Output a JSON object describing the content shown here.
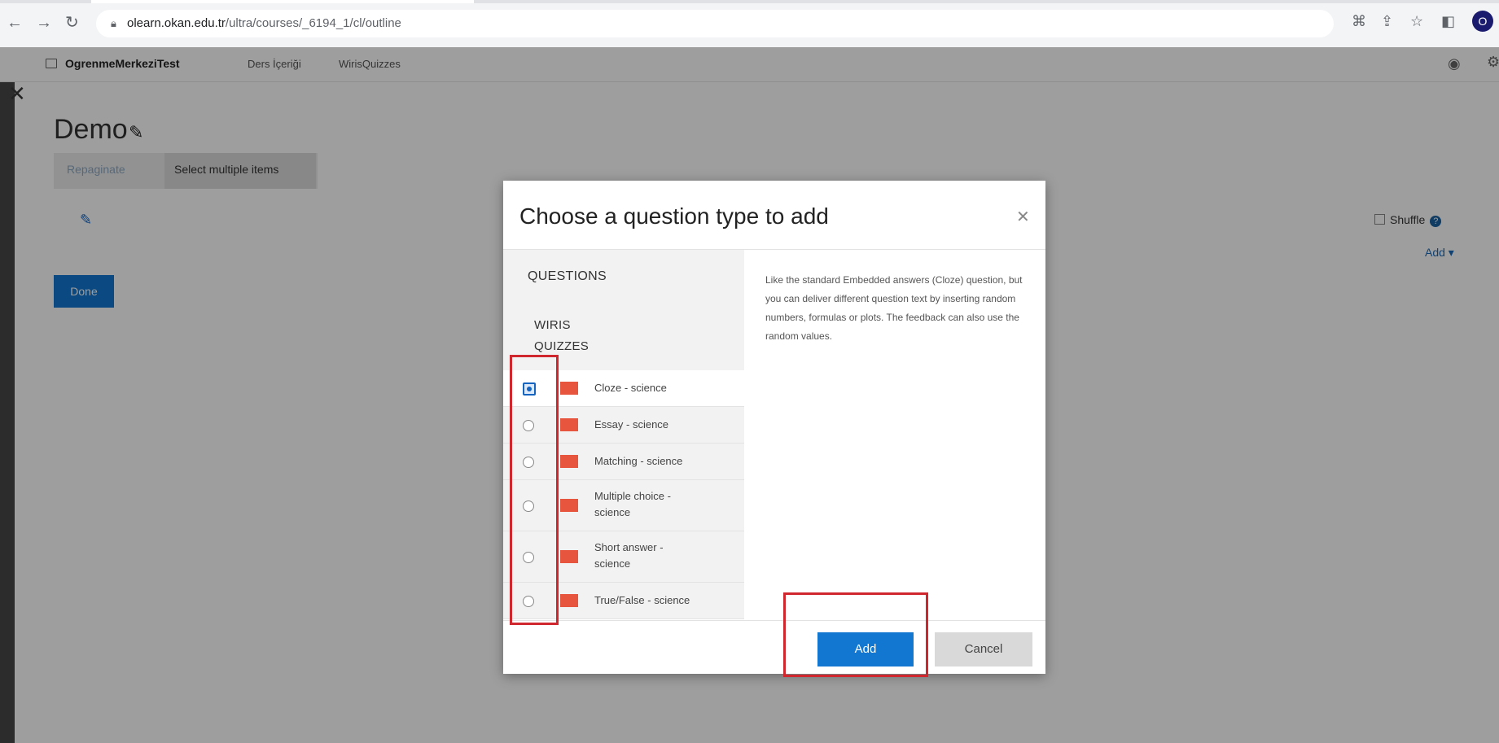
{
  "browser": {
    "url_host": "olearn.okan.edu.tr",
    "url_path": "/ultra/courses/_6194_1/cl/outline",
    "profile_initial": "O"
  },
  "app": {
    "course_name": "OgrenmeMerkeziTest",
    "nav_links": [
      "Ders İçeriği",
      "WirisQuizzes"
    ],
    "page_title": "Demo",
    "repaginate_label": "Repaginate",
    "select_multiple_label": "Select multiple items",
    "done_label": "Done",
    "shuffle_label": "Shuffle",
    "add_menu_label": "Add ▾"
  },
  "modal": {
    "title": "Choose a question type to add",
    "section_questions": "QUESTIONS",
    "section_wiris": "WIRIS QUIZZES",
    "items": [
      {
        "label": "Cloze - science",
        "selected": true
      },
      {
        "label": "Essay - science",
        "selected": false
      },
      {
        "label": "Matching - science",
        "selected": false
      },
      {
        "label": "Multiple choice - science",
        "selected": false
      },
      {
        "label": "Short answer - science",
        "selected": false
      },
      {
        "label": "True/False - science",
        "selected": false
      }
    ],
    "description": "Like the standard Embedded answers (Cloze) question, but you can deliver different question text by inserting random numbers, formulas or plots. The feedback can also use the random values.",
    "add_label": "Add",
    "cancel_label": "Cancel"
  },
  "colors": {
    "accent": "#1177d1",
    "highlight": "#d0262e",
    "icon_red": "#e8553e"
  },
  "icons": [
    "back-arrow-icon",
    "forward-arrow-icon",
    "reload-icon",
    "lock-icon",
    "translate-icon",
    "share-icon",
    "star-icon",
    "sidebar-icon",
    "eye-icon",
    "gear-icon",
    "close-icon",
    "pencil-icon",
    "help-icon"
  ]
}
